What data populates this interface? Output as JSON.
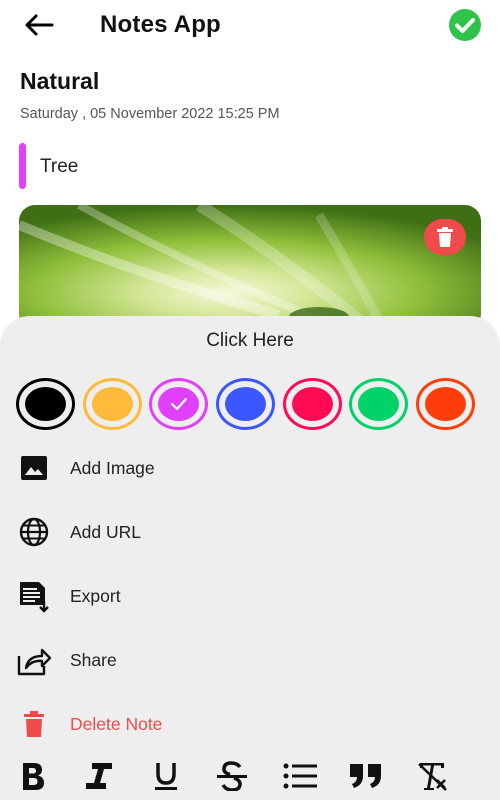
{
  "header": {
    "title": "Notes App"
  },
  "note": {
    "title": "Natural",
    "date": "Saturday , 05 November 2022 15:25 PM",
    "subtitle": "Tree",
    "accent_color": "#e040fb"
  },
  "sheet": {
    "title": "Click Here",
    "colors": [
      {
        "name": "black",
        "hex": "#000000",
        "selected": false
      },
      {
        "name": "yellow",
        "hex": "#ffba3b",
        "selected": false
      },
      {
        "name": "purple",
        "hex": "#e040fb",
        "selected": true
      },
      {
        "name": "blue",
        "hex": "#3a56ff",
        "selected": false
      },
      {
        "name": "pink",
        "hex": "#ff0a55",
        "selected": false
      },
      {
        "name": "green",
        "hex": "#00d26a",
        "selected": false
      },
      {
        "name": "orange",
        "hex": "#ff3d0a",
        "selected": false
      }
    ],
    "menu": {
      "add_image": "Add Image",
      "add_url": "Add URL",
      "export": "Export",
      "share": "Share",
      "delete_note": "Delete Note"
    },
    "format_tools": [
      "bold-icon",
      "italic-icon",
      "underline-icon",
      "strikethrough-icon",
      "bulleted-list-icon",
      "quote-icon",
      "clear-format-icon"
    ]
  },
  "colors": {
    "check_green": "#2fc34a",
    "delete_red": "#ef4b4b",
    "sheet_bg": "#eeeeee"
  }
}
